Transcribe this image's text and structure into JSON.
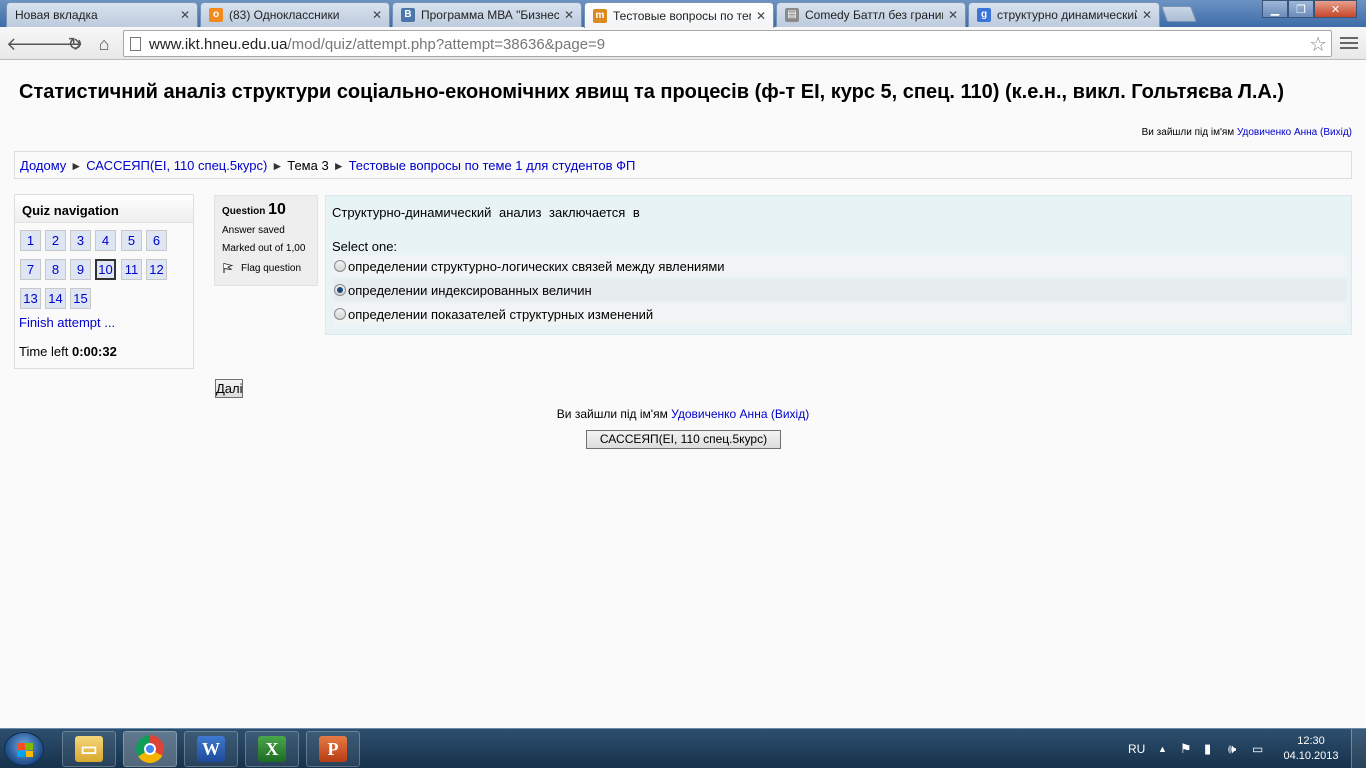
{
  "browser": {
    "tabs": [
      {
        "title": "Новая вкладка",
        "icon": "blank-page-icon",
        "active": false
      },
      {
        "title": "(83) Одноклассники",
        "icon": "odnoklassniki-icon",
        "active": false
      },
      {
        "title": "Программа МВА \"Бизнес",
        "icon": "vk-icon",
        "active": false
      },
      {
        "title": "Тестовые вопросы по теме",
        "icon": "moodle-icon",
        "active": true
      },
      {
        "title": "Comedy Баттл без границ",
        "icon": "film-icon",
        "active": false
      },
      {
        "title": "структурно динамический",
        "icon": "google-icon",
        "active": false
      }
    ],
    "url_host": "www.ikt.hneu.edu.ua",
    "url_path": "/mod/quiz/attempt.php?attempt=38636&page=9"
  },
  "page": {
    "heading": "Статистичний аналіз структури соціально-економічних явищ та процесів (ф-т ЕІ, курс 5, спец. 110) (к.е.н., викл. Гольтяєва Л.А.)",
    "login_prefix": "Ви зайшли під ім'ям",
    "user_name": "Удовиченко Анна",
    "logout_label": "(Вихід)",
    "breadcrumb": {
      "home": "Додому",
      "sep": "►",
      "course": "САССЕЯП(ЕІ, 110 спец.5курс)",
      "topic": "Тема 3",
      "quiz": "Тестовые вопросы по теме 1 для студентов ФП"
    }
  },
  "quiz_nav": {
    "title": "Quiz navigation",
    "questions": [
      "1",
      "2",
      "3",
      "4",
      "5",
      "6",
      "7",
      "8",
      "9",
      "10",
      "11",
      "12",
      "13",
      "14",
      "15"
    ],
    "current": "10",
    "finish_label": "Finish attempt ...",
    "time_left_label": "Time left",
    "time_left_value": "0:00:32"
  },
  "question": {
    "label": "Question",
    "number": "10",
    "state": "Answer saved",
    "grade": "Marked out of 1,00",
    "flag_label": "Flag question",
    "text": "Структурно-динамический анализ заключается в",
    "prompt": "Select one:",
    "answers": [
      {
        "text": "определении структурно-логических связей между явлениями",
        "checked": false
      },
      {
        "text": "определении индексированных величин",
        "checked": true
      },
      {
        "text": "определении показателей  структурных  изменений",
        "checked": false
      }
    ]
  },
  "buttons": {
    "next": "Далі",
    "course": "САССЕЯП(ЕІ, 110 спец.5курс)"
  },
  "taskbar": {
    "apps": [
      "explorer-icon",
      "chrome-icon",
      "word-icon",
      "excel-icon",
      "powerpoint-icon"
    ],
    "language": "RU",
    "time": "12:30",
    "date": "04.10.2013"
  }
}
